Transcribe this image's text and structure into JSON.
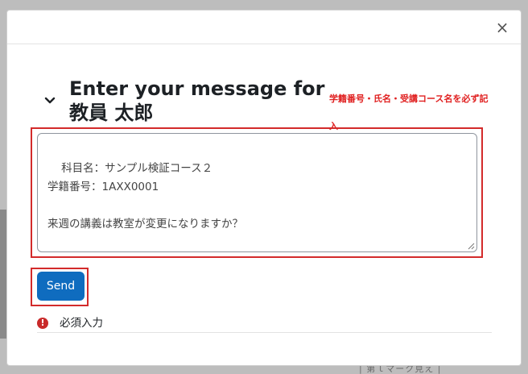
{
  "modal": {
    "close_label": "×",
    "heading": "Enter your message for 教員 太郎",
    "annotation": "学籍番号・氏名・受講コース名を必ず記入"
  },
  "message": {
    "text": "科目名：サンプル検証コース２\n学籍番号：1AXX0001\n\n来週の講義は教室が変更になりますか？"
  },
  "actions": {
    "send_label": "Send"
  },
  "form": {
    "required_icon": "!",
    "required_label": "必須入力"
  },
  "background": {
    "fragment_text": "| 第ｌマーク見え |"
  },
  "colors": {
    "primary": "#0f6cbf",
    "highlight_box": "#d32b2b",
    "annotation_text": "#e02020",
    "required_icon": "#c92a2a"
  }
}
